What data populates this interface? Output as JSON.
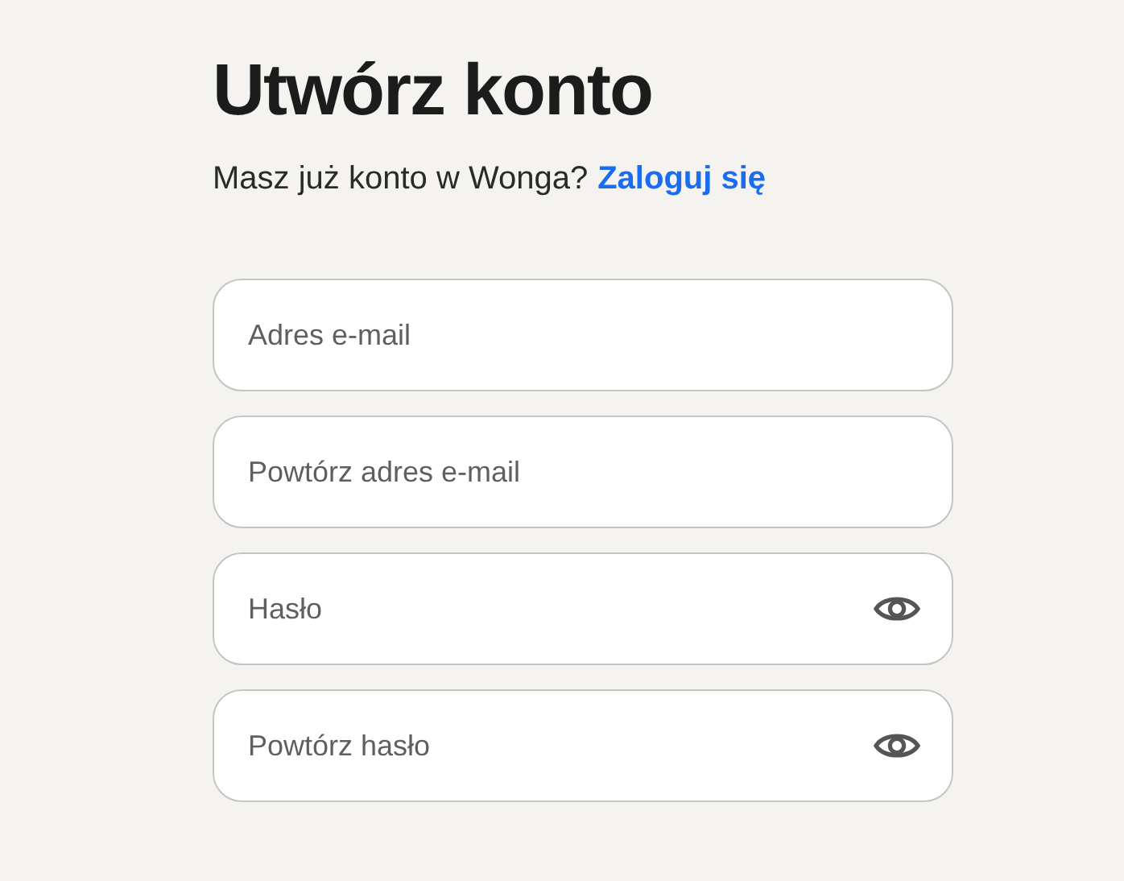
{
  "title": "Utwórz konto",
  "subtitle": {
    "text": "Masz już konto w Wonga?",
    "link": "Zaloguj się"
  },
  "fields": [
    {
      "kind": "email",
      "placeholder": "Adres e-mail"
    },
    {
      "kind": "email",
      "placeholder": "Powtórz adres e-mail"
    },
    {
      "kind": "password",
      "placeholder": "Hasło"
    },
    {
      "kind": "password",
      "placeholder": "Powtórz hasło"
    }
  ]
}
